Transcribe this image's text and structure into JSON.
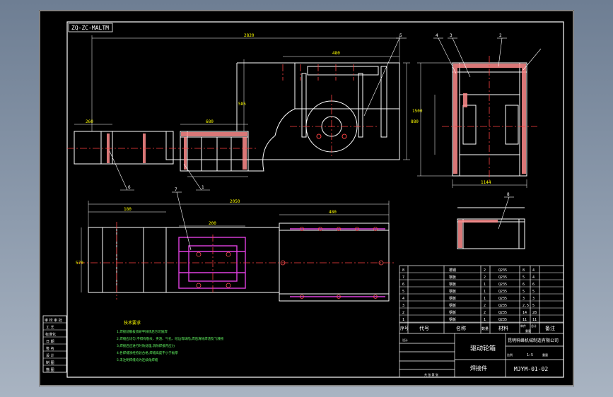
{
  "drawing": {
    "corner_code": "ZQ-ZC-MALTM",
    "stamp_cells": [
      "审 校 审 批",
      "工 艺",
      "标准化",
      "日 期",
      "签 名",
      "设 计",
      "制 图",
      "描 图"
    ],
    "dims": {
      "top_len": "2820",
      "h_total": "1500",
      "part_h": "585",
      "w_480": "480",
      "w_680": "680",
      "d_260": "260",
      "w_right": "1144",
      "h_right": "880",
      "bottom_len": "2050",
      "b_480": "480",
      "b_570": "570",
      "b_180": "180",
      "b_200": "200"
    },
    "balloons": [
      "1",
      "2",
      "3",
      "4",
      "5",
      "6",
      "7",
      "8"
    ]
  },
  "notes": {
    "title": "技术要求",
    "lines": [
      "1.焊接前钢板须矫平除锈后方可施焊",
      "2.焊缝应均匀,不得有裂纹、夹渣、气孔、咬边等缺陷,焊后清除焊渣及飞溅物",
      "3.焊接后应进行时效处理,消除焊接内应力",
      "4.各焊缝须经检验合格,焊缝高度不小于板厚",
      "5.未注明焊缝均为连续角焊缝"
    ]
  },
  "title_block": {
    "headers": [
      "序号",
      "代号",
      "名称",
      "数量",
      "材料",
      "单件",
      "总计",
      "重量",
      "备注"
    ],
    "parts": [
      {
        "no": "8",
        "name": "槽钢",
        "qty": "2",
        "mat": "Q235",
        "w1": "8",
        "w2": "4"
      },
      {
        "no": "7",
        "name": "钢板",
        "qty": "2",
        "mat": "Q235",
        "w1": "5",
        "w2": "4"
      },
      {
        "no": "6",
        "name": "钢板",
        "qty": "1",
        "mat": "Q235",
        "w1": "6",
        "w2": "6"
      },
      {
        "no": "5",
        "name": "钢板",
        "qty": "1",
        "mat": "Q235",
        "w1": "5",
        "w2": "5"
      },
      {
        "no": "4",
        "name": "钢板",
        "qty": "1",
        "mat": "Q235",
        "w1": "3",
        "w2": "3"
      },
      {
        "no": "3",
        "name": "钢板",
        "qty": "2",
        "mat": "Q235",
        "w1": "2.5",
        "w2": "5"
      },
      {
        "no": "2",
        "name": "钢板",
        "qty": "2",
        "mat": "Q235",
        "w1": "14",
        "w2": "28"
      },
      {
        "no": "1",
        "name": "钢板",
        "qty": "1",
        "mat": "Q235",
        "w1": "11",
        "w2": "11"
      }
    ],
    "drawing_title": "驱动轮箱",
    "company": "昆明科峰机械制造有限公司",
    "type_label": "焊接件",
    "drawing_no": "MJYM-01-02",
    "scale": "1:5",
    "ratio_label": "比例",
    "weight_label": "重量",
    "design_label": "设计",
    "sheet_label": "共 张 第 张"
  }
}
